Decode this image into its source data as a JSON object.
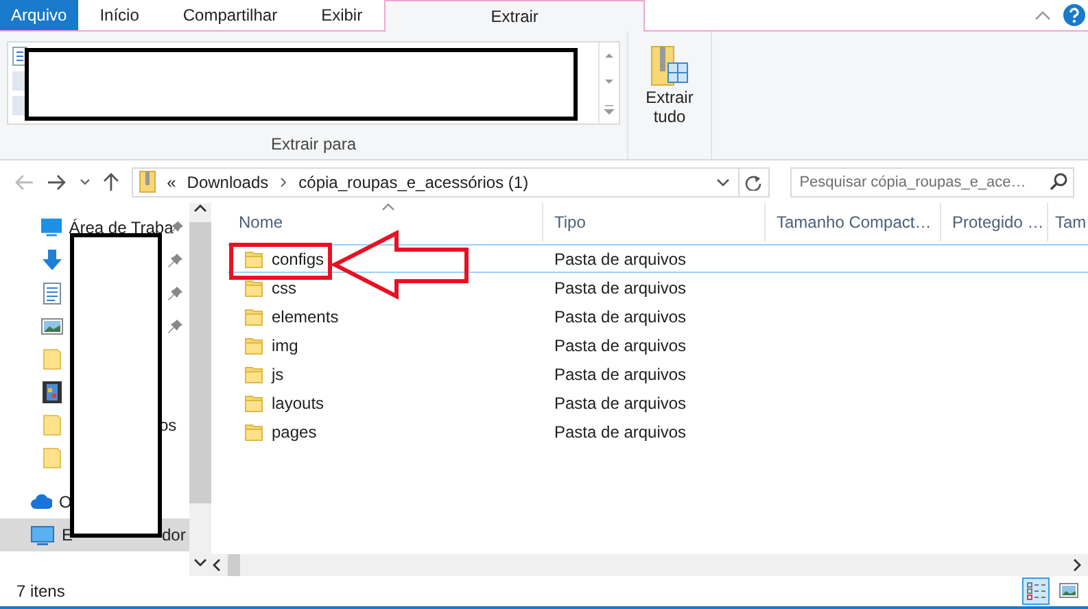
{
  "ribbon": {
    "tabs": [
      {
        "label": "Arquivo",
        "kind": "file",
        "selected": false
      },
      {
        "label": "Início",
        "kind": "tab",
        "selected": false
      },
      {
        "label": "Compartilhar",
        "kind": "tab",
        "selected": false
      },
      {
        "label": "Exibir",
        "kind": "tab",
        "selected": false
      },
      {
        "label": "Extrair",
        "kind": "contextual",
        "selected": true
      }
    ],
    "gallery": {
      "label": "Extrair para",
      "redacted": true
    },
    "extract_all": {
      "label": "Extrair tudo"
    }
  },
  "address_bar": {
    "overflow": "«",
    "segments": [
      "Downloads",
      "cópia_roupas_e_acessórios (1)"
    ]
  },
  "search": {
    "placeholder": "Pesquisar cópia_roupas_e_ace…"
  },
  "sidebar": {
    "redacted": true,
    "items": [
      {
        "kind": "desktop",
        "label": "Área de Traba",
        "pinned": true,
        "selected": false
      },
      {
        "kind": "download",
        "pinned": true,
        "selected": false
      },
      {
        "kind": "document",
        "pinned": true,
        "selected": false
      },
      {
        "kind": "picture",
        "pinned": true,
        "selected": false
      },
      {
        "kind": "folder",
        "pinned": false,
        "selected": false
      },
      {
        "kind": "video",
        "pinned": false,
        "selected": false
      },
      {
        "kind": "folder",
        "label_end": "os",
        "pinned": false,
        "selected": false
      },
      {
        "kind": "folder",
        "pinned": false,
        "selected": false
      },
      {
        "kind": "cloud",
        "label": "O",
        "pinned": false,
        "selected": false
      },
      {
        "kind": "computer",
        "label": "E",
        "label_end": "dor",
        "pinned": false,
        "selected": true
      }
    ]
  },
  "columns": [
    "Nome",
    "Tipo",
    "Tamanho Compact…",
    "Protegido …",
    "Tam"
  ],
  "rows": [
    {
      "name": "configs",
      "type": "Pasta de arquivos",
      "focused": true,
      "marked": true
    },
    {
      "name": "css",
      "type": "Pasta de arquivos",
      "focused": false,
      "marked": false
    },
    {
      "name": "elements",
      "type": "Pasta de arquivos",
      "focused": false,
      "marked": false
    },
    {
      "name": "img",
      "type": "Pasta de arquivos",
      "focused": false,
      "marked": false
    },
    {
      "name": "js",
      "type": "Pasta de arquivos",
      "focused": false,
      "marked": false
    },
    {
      "name": "layouts",
      "type": "Pasta de arquivos",
      "focused": false,
      "marked": false
    },
    {
      "name": "pages",
      "type": "Pasta de arquivos",
      "focused": false,
      "marked": false
    }
  ],
  "status_bar": {
    "count": "7 itens",
    "views": [
      {
        "kind": "details",
        "selected": true
      },
      {
        "kind": "thumbnails",
        "selected": false
      }
    ]
  }
}
